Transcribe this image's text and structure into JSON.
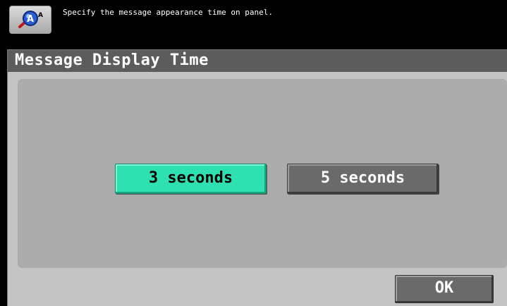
{
  "header": {
    "message": "Specify the message appearance time on panel.",
    "help_icon": "help-magnifier-icon"
  },
  "title": "Message Display Time",
  "options": [
    {
      "label": "3 seconds",
      "selected": true
    },
    {
      "label": "5 seconds",
      "selected": false
    }
  ],
  "footer": {
    "ok_label": "OK"
  },
  "colors": {
    "selected": "#2fe0b0",
    "unselected": "#6a6a6a",
    "titlebar": "#5c5c5c",
    "panel": "#acacac"
  }
}
